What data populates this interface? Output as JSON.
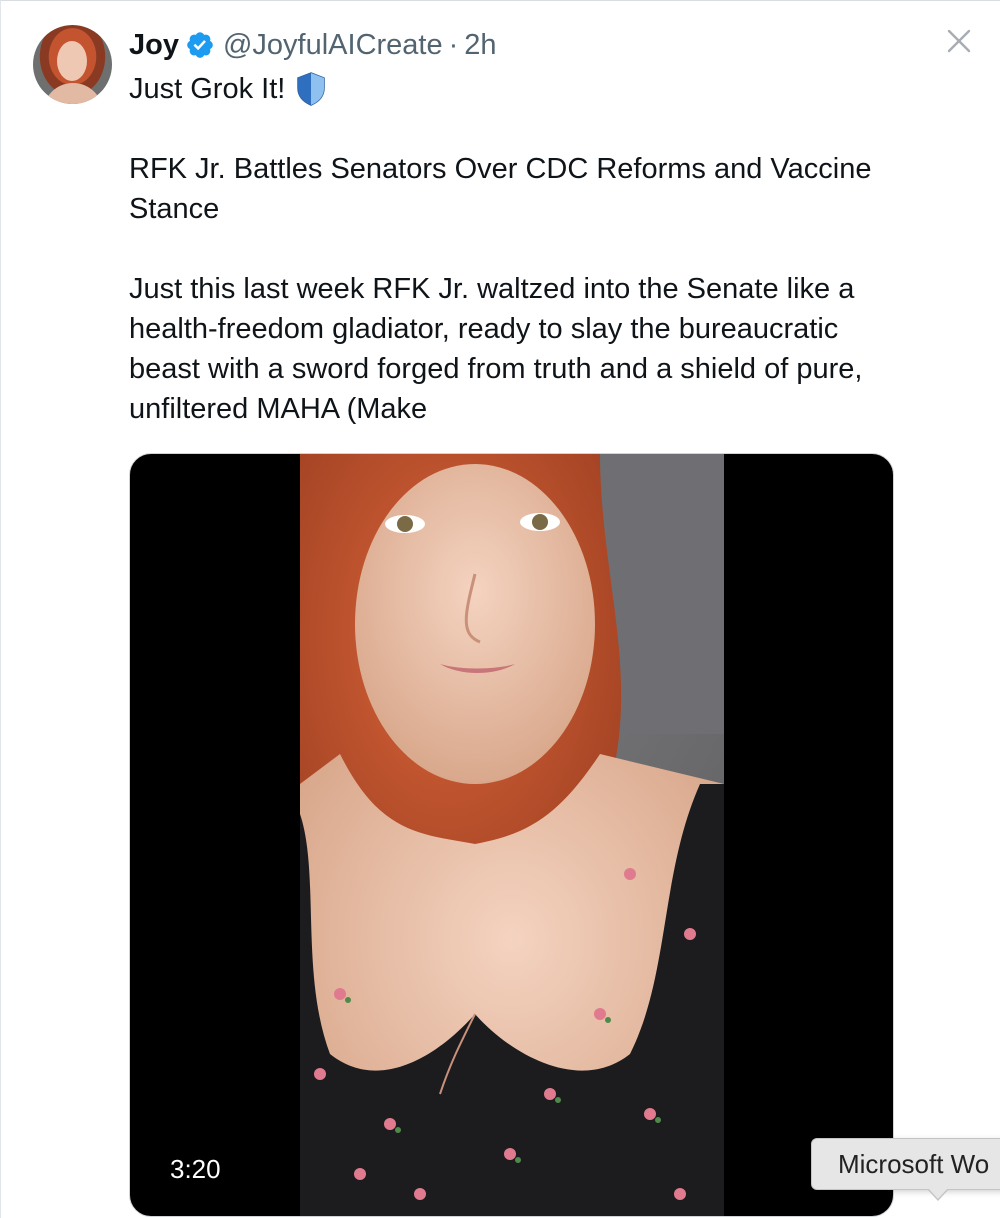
{
  "tweet": {
    "author": {
      "display_name": "Joy",
      "handle": "@JoyfulAICreate",
      "separator": "·",
      "time": "2h",
      "verified_icon": "verified-badge-icon",
      "verified_color": "#1d9bf0"
    },
    "tagline": "Just Grok It!",
    "tagline_icon": "blue-shield-icon",
    "headline": "RFK Jr. Battles Senators Over CDC Reforms and Vaccine Stance",
    "body": "Just this last week RFK Jr. waltzed into the Senate like a health-freedom gladiator, ready to slay the bureaucratic beast with a sword forged from truth and a shield of pure, unfiltered MAHA (Make",
    "media": {
      "type": "video",
      "duration": "3:20"
    }
  },
  "window": {
    "close_icon": "close-x-icon"
  },
  "tooltip": {
    "text": "Microsoft Wo"
  },
  "colors": {
    "text_primary": "#0f1419",
    "text_secondary": "#536471",
    "accent": "#1d9bf0",
    "background": "#ffffff"
  }
}
